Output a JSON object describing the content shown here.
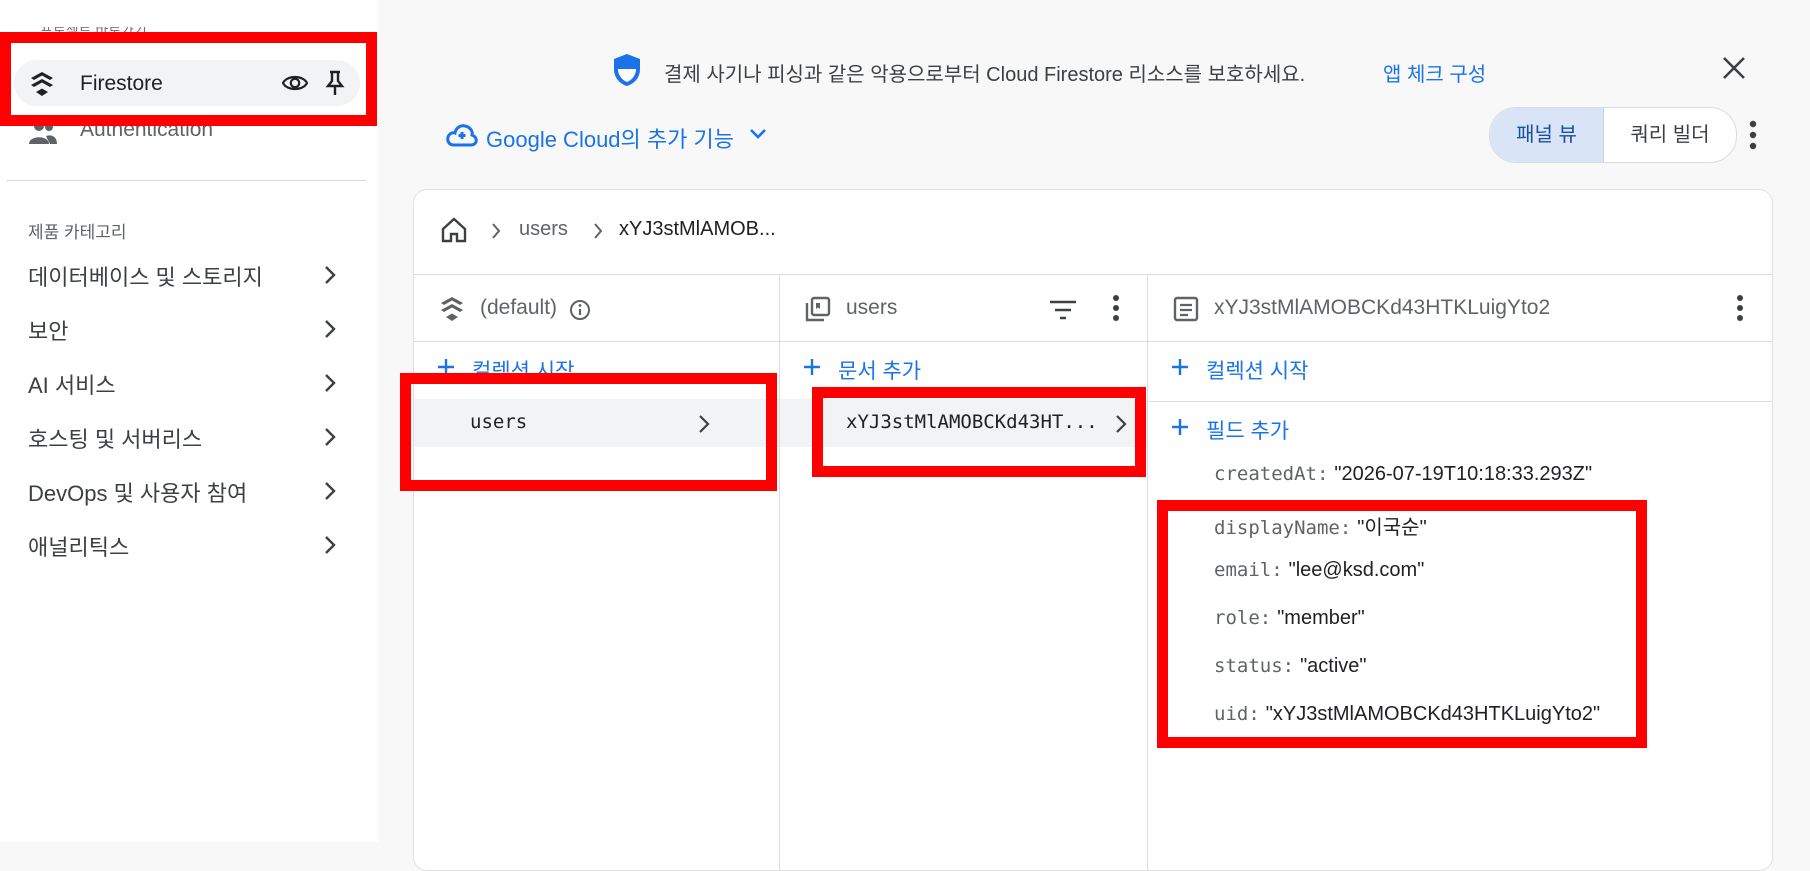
{
  "sidebar": {
    "firestore_label": "Firestore",
    "auth_label": "Authentication",
    "category_title": "제품 카테고리",
    "categories": [
      {
        "label": "데이터베이스 및 스토리지"
      },
      {
        "label": "보안"
      },
      {
        "label": "AI 서비스"
      },
      {
        "label": "호스팅 및 서버리스"
      },
      {
        "label": "DevOps 및 사용자 참여"
      },
      {
        "label": "애널리틱스"
      }
    ]
  },
  "banner": {
    "text": "결제 사기나 피싱과 같은 악용으로부터 Cloud Firestore 리소스를 보호하세요.",
    "link": "앱 체크 구성"
  },
  "toolbar": {
    "google_cloud_label": "Google Cloud의 추가 기능",
    "panel_view_label": "패널 뷰",
    "query_builder_label": "쿼리 빌더"
  },
  "breadcrumb": {
    "collection": "users",
    "document": "xYJ3stMlAMOB..."
  },
  "col_db": {
    "title": "(default)",
    "start_collection": "컬렉션 시작",
    "items": [
      "users"
    ]
  },
  "col_collection": {
    "title": "users",
    "add_document": "문서 추가",
    "items": [
      "xYJ3stMlAMOBCKd43HT..."
    ]
  },
  "col_document": {
    "title": "xYJ3stMlAMOBCKd43HTKLuigYto2",
    "start_collection": "컬렉션 시작",
    "add_field": "필드 추가",
    "fields": [
      {
        "key": "createdAt:",
        "value": "\"2026-07-19T10:18:33.293Z\""
      },
      {
        "key": "displayName:",
        "value": "\"이국순\""
      },
      {
        "key": "email:",
        "value": "\"lee@ksd.com\""
      },
      {
        "key": "role:",
        "value": "\"member\""
      },
      {
        "key": "status:",
        "value": "\"active\""
      },
      {
        "key": "uid:",
        "value": "\"xYJ3stMlAMOBCKd43HTKLuigYto2\""
      }
    ]
  },
  "colors": {
    "accent": "#1a73e8",
    "highlight": "#ff0000",
    "selected_toggle": "#d9e5f7"
  }
}
